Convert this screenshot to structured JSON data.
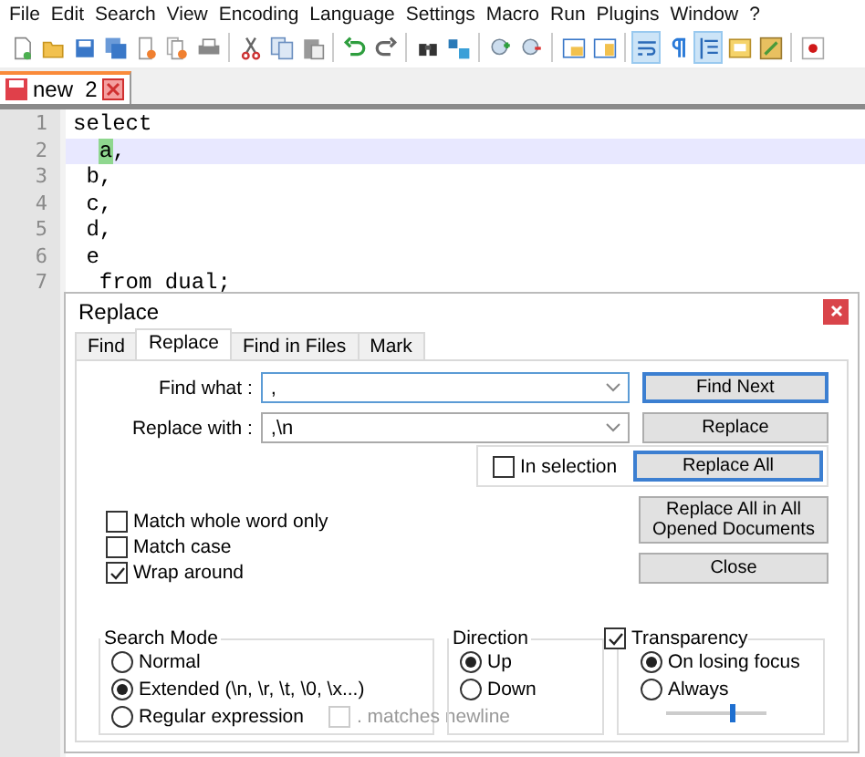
{
  "menu": [
    "File",
    "Edit",
    "Search",
    "View",
    "Encoding",
    "Language",
    "Settings",
    "Macro",
    "Run",
    "Plugins",
    "Window",
    "?"
  ],
  "toolbar": [
    {
      "kind": "new",
      "selected": false
    },
    {
      "kind": "open",
      "selected": false
    },
    {
      "kind": "save",
      "selected": false
    },
    {
      "kind": "saveall",
      "selected": false
    },
    {
      "kind": "close",
      "selected": false
    },
    {
      "kind": "closeall",
      "selected": false
    },
    {
      "kind": "print",
      "selected": false
    },
    {
      "kind": "sep"
    },
    {
      "kind": "cut",
      "selected": false
    },
    {
      "kind": "copy",
      "selected": false
    },
    {
      "kind": "paste",
      "selected": false
    },
    {
      "kind": "sep"
    },
    {
      "kind": "undo",
      "selected": false
    },
    {
      "kind": "redo",
      "selected": false
    },
    {
      "kind": "sep"
    },
    {
      "kind": "find",
      "selected": false
    },
    {
      "kind": "replace",
      "selected": false
    },
    {
      "kind": "sep"
    },
    {
      "kind": "zoomin",
      "selected": false
    },
    {
      "kind": "zoomout",
      "selected": false
    },
    {
      "kind": "sep"
    },
    {
      "kind": "syncv",
      "selected": false
    },
    {
      "kind": "synch",
      "selected": false
    },
    {
      "kind": "sep"
    },
    {
      "kind": "wrap",
      "selected": true
    },
    {
      "kind": "pilcrow",
      "selected": false
    },
    {
      "kind": "indent",
      "selected": true
    },
    {
      "kind": "docmap",
      "selected": false
    },
    {
      "kind": "funclist",
      "selected": false
    },
    {
      "kind": "sep"
    },
    {
      "kind": "record",
      "selected": false
    }
  ],
  "doc_tabs": [
    {
      "label": "new  2",
      "selected": true
    }
  ],
  "editor": {
    "lines": [
      {
        "number": "1",
        "current": false,
        "parts": [
          {
            "text": "select",
            "highlighted": false
          }
        ]
      },
      {
        "number": "2",
        "current": true,
        "parts": [
          {
            "text": "  a",
            "highlighted": true
          },
          {
            "text": ",",
            "highlighted": false
          }
        ]
      },
      {
        "number": "3",
        "current": false,
        "parts": [
          {
            "text": " b,",
            "highlighted": false
          }
        ]
      },
      {
        "number": "4",
        "current": false,
        "parts": [
          {
            "text": " c,",
            "highlighted": false
          }
        ]
      },
      {
        "number": "5",
        "current": false,
        "parts": [
          {
            "text": " d,",
            "highlighted": false
          }
        ]
      },
      {
        "number": "6",
        "current": false,
        "parts": [
          {
            "text": " e",
            "highlighted": false
          }
        ]
      },
      {
        "number": "7",
        "current": false,
        "parts": [
          {
            "text": "  from dual;",
            "highlighted": false
          }
        ]
      }
    ]
  },
  "dialog": {
    "title": "Replace",
    "tabs": [
      {
        "label": "Find",
        "selected": false
      },
      {
        "label": "Replace",
        "selected": true
      },
      {
        "label": "Find in Files",
        "selected": false
      },
      {
        "label": "Mark",
        "selected": false
      }
    ],
    "find_what": {
      "label": "Find what :",
      "value": ",",
      "focused": true
    },
    "replace_with": {
      "label": "Replace with :",
      "value": ",\\n",
      "focused": false
    },
    "in_selection": {
      "label": "In selection",
      "checked": false
    },
    "buttons": [
      {
        "label": "Find Next",
        "focused": true
      },
      {
        "label": "Replace",
        "focused": false
      },
      {
        "label": "Replace All",
        "focused": true
      },
      {
        "label": "Replace All in All Opened Documents",
        "focused": false
      },
      {
        "label": "Close",
        "focused": false
      }
    ],
    "options": [
      {
        "label": "Match whole word only",
        "checked": false
      },
      {
        "label": "Match case",
        "checked": false
      },
      {
        "label": "Wrap around",
        "checked": true
      }
    ],
    "search_mode": {
      "title": "Search Mode",
      "options": [
        {
          "label": "Normal",
          "selected": false
        },
        {
          "label": "Extended (\\n, \\r, \\t, \\0, \\x...)",
          "selected": true
        },
        {
          "label": "Regular expression",
          "selected": false
        }
      ],
      "matches_newline": {
        "label": ". matches newline",
        "checked": false,
        "disabled": true
      }
    },
    "direction": {
      "title": "Direction",
      "options": [
        {
          "label": "Up",
          "selected": true
        },
        {
          "label": "Down",
          "selected": false
        }
      ]
    },
    "transparency": {
      "label": "Transparency",
      "checked": true,
      "options": [
        {
          "label": "On losing focus",
          "selected": true
        },
        {
          "label": "Always",
          "selected": false
        }
      ],
      "level": 0.65
    }
  }
}
